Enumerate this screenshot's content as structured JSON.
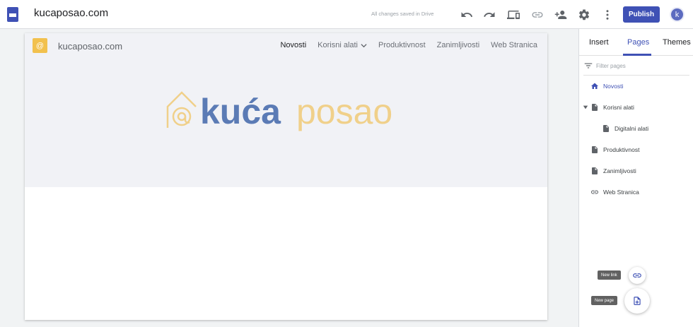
{
  "topbar": {
    "title": "kucaposao.com",
    "save_status": "All changes saved in Drive",
    "publish_label": "Publish",
    "avatar_initial": "k"
  },
  "canvas": {
    "site_name": "kucaposao.com",
    "nav": [
      {
        "label": "Novosti",
        "active": true
      },
      {
        "label": "Korisni alati",
        "has_dropdown": true
      },
      {
        "label": "Produktivnost"
      },
      {
        "label": "Zanimljivosti"
      },
      {
        "label": "Web Stranica"
      }
    ],
    "logo": {
      "part1": "kuća",
      "part2": "posao",
      "colors": {
        "primary": "#5b7bb5",
        "accent": "#f0d08a"
      }
    }
  },
  "panel": {
    "tabs": [
      "Insert",
      "Pages",
      "Themes"
    ],
    "active_tab": "Pages",
    "filter_placeholder": "Filter pages",
    "pages": [
      {
        "label": "Novosti",
        "icon": "home-icon"
      },
      {
        "label": "Korisni alati",
        "icon": "page-icon"
      },
      {
        "label": "Digitalni alati",
        "icon": "page-icon"
      },
      {
        "label": "Produktivnost",
        "icon": "page-icon"
      },
      {
        "label": "Zanimljivosti",
        "icon": "page-icon"
      },
      {
        "label": "Web Stranica",
        "icon": "link-icon"
      }
    ],
    "new_link_tooltip": "New link",
    "new_page_tooltip": "New page"
  },
  "colors": {
    "accent": "#3f51b5",
    "background": "#f1f3f4"
  }
}
